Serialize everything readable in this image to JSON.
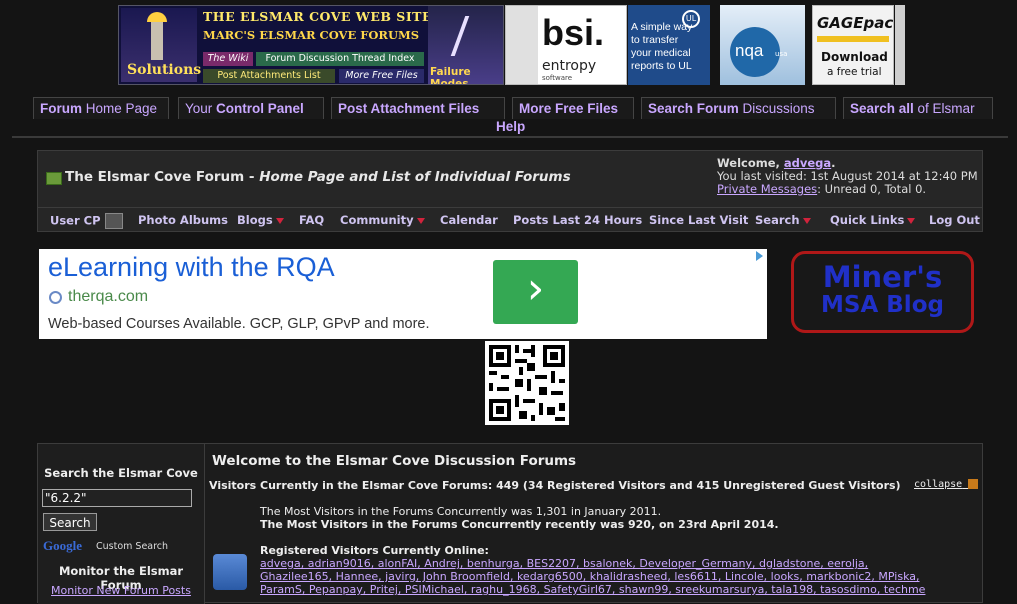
{
  "banners": {
    "elsmar_title": "THE ELSMAR COVE WEB SITE",
    "elsmar_sub": "MARC'S ELSMAR COVE FORUMS",
    "solutions": "Solutions",
    "wiki": "The Wiki",
    "thread_index": "Forum Discussion Thread Index",
    "post_attachments": "Post Attachments List",
    "more_free_files": "More Free Files",
    "failure_modes": "Failure Modes",
    "bsi": "bsi.",
    "entropy": "entropy",
    "entropy_sub": "software",
    "ul_text": "A simple way to transfer your medical reports to UL",
    "nqa": "nqa",
    "nqa_sub": "usa",
    "gagepack": "GAGEpack",
    "gagepack_download": "Download",
    "gagepack_trial": "a free trial"
  },
  "topnav": [
    {
      "bold": "Forum",
      "rest": " Home Page"
    },
    {
      "bold": "Control Panel",
      "pre": "Your "
    },
    {
      "bold": "Post Attachment Files",
      "rest": ""
    },
    {
      "bold": "More Free Files",
      "rest": ""
    },
    {
      "bold": "Search Forum",
      "rest": " Discussions"
    },
    {
      "bold": "Search all",
      "rest": " of Elsmar"
    },
    {
      "bold": "Help",
      "rest": ""
    }
  ],
  "forum_header": {
    "title": "The Elsmar Cove Forum",
    "separator": " - ",
    "subtitle": "Home Page and List of Individual Forums",
    "welcome": "Welcome, ",
    "username": "advega",
    "last_visited": "You last visited: 1st August 2014 at 12:40 PM",
    "pm_link": "Private Messages",
    "pm_rest": ": Unread 0, Total 0."
  },
  "navbar": [
    "User CP",
    "Photo Albums",
    "Blogs",
    "FAQ",
    "Community",
    "Calendar",
    "Posts Last 24 Hours",
    "Since Last Visit",
    "Search",
    "Quick Links",
    "Log Out"
  ],
  "ad": {
    "headline": "eLearning with the RQA",
    "domain": "therqa.com",
    "body": "Web-based Courses Available. GCP, GLP, GPvP and more.",
    "arrow": "›"
  },
  "miners": {
    "line1": "Miner's",
    "line2": "MSA Blog"
  },
  "sidebar": {
    "search_title": "Search the Elsmar Cove",
    "search_value": "\"6.2.2\"",
    "search_button": "Search",
    "google": "Google",
    "custom_search": "Custom Search",
    "monitor_title": "Monitor the Elsmar Forum",
    "monitor_link": "Monitor New Forum Posts"
  },
  "content": {
    "welcome_title": "Welcome to the Elsmar Cove Discussion Forums",
    "visitors_line": "Visitors Currently in the Elsmar Cove Forums: 449 (34 Registered Visitors and 415 Unregistered Guest Visitors)",
    "collapse": "collapse",
    "most_visitors": "The Most Visitors in the Forums Concurrently was 1,301 in January 2011.",
    "most_recent": "The Most Visitors in the Forums Concurrently recently was 920, on 23rd April 2014.",
    "registered_title": "Registered Visitors Currently Online:",
    "users_line1": "advega, adrian9016, alonFAI, Andrej, benhurga, BES2207, bsalonek, Developer_Germany, dgladstone, eerolja,",
    "users_line2": "Ghazilee165, Hannee, javirg, John Broomfield, kedarg6500, khalidrasheed, les6611, Lincole, looks, markbonic2, MPiska,",
    "users_line3": "ParamS, Pepanpay, Pritej, PSIMichael, raghu_1968, SafetyGirl67, shawn99, sreekumarsurya, tala198, tasosdimo, techme"
  }
}
